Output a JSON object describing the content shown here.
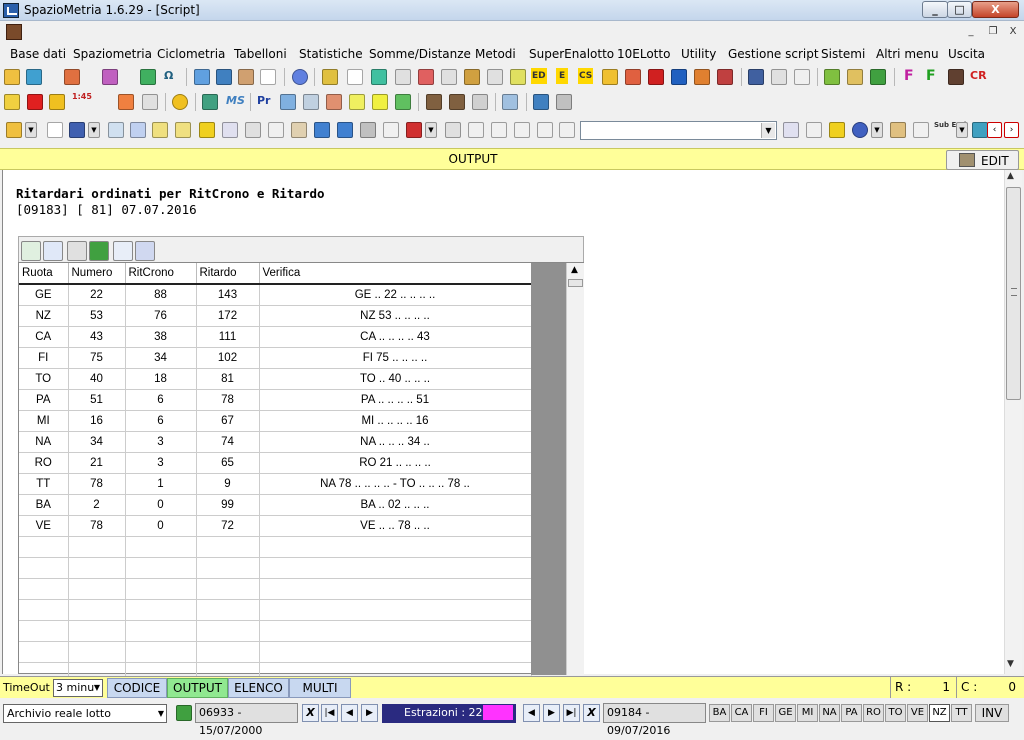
{
  "window": {
    "title": "SpazioMetria  1.6.29 - [Script]",
    "min": "_",
    "max": "□",
    "close": "X"
  },
  "mdi": {
    "min": "_",
    "restore": "❐",
    "close": "X"
  },
  "menu": [
    "Base dati",
    "Spaziometria",
    "Ciclometria",
    "Tabelloni",
    "Statistiche",
    "Somme/Distanze",
    "Metodi",
    "SuperEnalotto",
    "10ELotto",
    "Utility",
    "Gestione script",
    "Sistemi",
    "Altri menu",
    "Uscita"
  ],
  "toolbar_text": {
    "omega": "Ω",
    "ed": "ED",
    "e": "E",
    "cs": "CS",
    "f1": "F",
    "f2": "F",
    "cr": "CR",
    "n145": "1:45",
    "ms": "MS",
    "pr": "Pr",
    "sub_end": "Sub End"
  },
  "output_bar": {
    "label": "OUTPUT",
    "edit_label": "EDIT"
  },
  "report": {
    "title": "Ritardari ordinati per RitCrono e Ritardo",
    "subtitle": "[09183] [ 81] 07.07.2016"
  },
  "table": {
    "columns": [
      "Ruota",
      "Numero",
      "RitCrono",
      "Ritardo",
      "Verifica"
    ],
    "rows": [
      [
        "GE",
        "22",
        "88",
        "143",
        "GE .. 22 .. .. .. .."
      ],
      [
        "NZ",
        "53",
        "76",
        "172",
        "NZ 53 .. .. .. .."
      ],
      [
        "CA",
        "43",
        "38",
        "111",
        "CA .. .. .. .. 43"
      ],
      [
        "FI",
        "75",
        "34",
        "102",
        "FI 75 .. .. .. .."
      ],
      [
        "TO",
        "40",
        "18",
        "81",
        "TO .. 40 .. .. .."
      ],
      [
        "PA",
        "51",
        "6",
        "78",
        "PA .. .. .. .. 51"
      ],
      [
        "MI",
        "16",
        "6",
        "67",
        "MI .. .. .. .. 16"
      ],
      [
        "NA",
        "34",
        "3",
        "74",
        "NA .. .. .. 34 .."
      ],
      [
        "RO",
        "21",
        "3",
        "65",
        "RO 21 .. .. .. .."
      ],
      [
        "TT",
        "78",
        "1",
        "9",
        "NA 78 .. .. .. .. - TO .. .. .. 78 .."
      ],
      [
        "BA",
        "2",
        "0",
        "99",
        "BA .. 02 .. .. .."
      ],
      [
        "VE",
        "78",
        "0",
        "72",
        "VE .. .. 78 .. .."
      ]
    ],
    "empty_rows": 7
  },
  "status": {
    "timeout_label": "TimeOut",
    "timeout_value": "3 minu",
    "tabs": [
      "CODICE",
      "OUTPUT",
      "ELENCO",
      "MULTI"
    ],
    "active_tab": "OUTPUT",
    "r_label": "R :",
    "r_value": "1",
    "c_label": "C :",
    "c_value": "0"
  },
  "bottom": {
    "archive": "Archivio reale lotto",
    "range_start": "06933 - 15/07/2000",
    "x_label": "X",
    "estrazioni": "Estrazioni : 225",
    "range_end": "09184 - 09/07/2016",
    "ruote": [
      "BA",
      "CA",
      "FI",
      "GE",
      "MI",
      "NA",
      "PA",
      "RO",
      "TO",
      "VE",
      "NZ",
      "TT"
    ],
    "selected_ruota": "NZ",
    "inv": "INV"
  },
  "colors": {
    "output_bar": "#ffff99",
    "active_tab": "#90e890",
    "tab": "#c8d8f0",
    "estrazioni_bg": "#2a2a80",
    "estrazioni_mark": "#ff33ff"
  }
}
